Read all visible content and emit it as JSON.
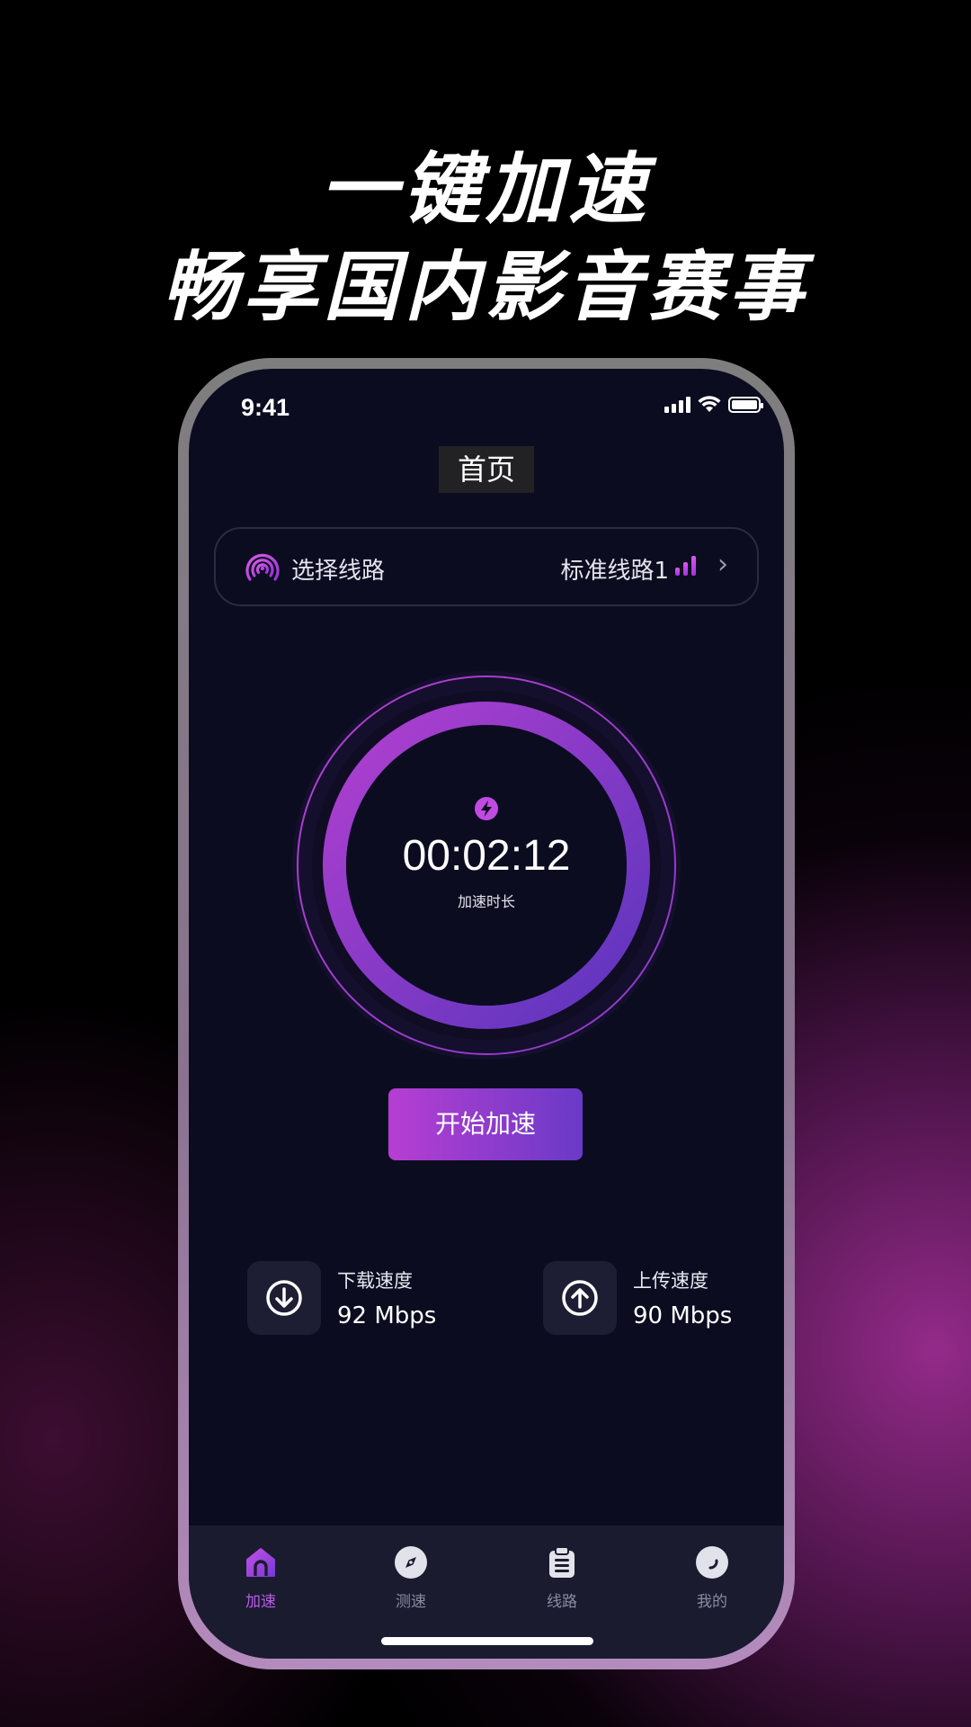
{
  "headline": {
    "line1": "一键加速",
    "line2": "畅享国内影音赛事"
  },
  "status_bar": {
    "time": "9:41"
  },
  "page": {
    "title": "首页"
  },
  "route_selector": {
    "label": "选择线路",
    "value": "标准线路1"
  },
  "timer": {
    "value": "00:02:12",
    "caption": "加速时长"
  },
  "start_button": {
    "label": "开始加速"
  },
  "speeds": {
    "download": {
      "label": "下载速度",
      "value": "92 Mbps"
    },
    "upload": {
      "label": "上传速度",
      "value": "90 Mbps"
    }
  },
  "tabbar": {
    "items": [
      {
        "label": "加速",
        "icon": "home-icon",
        "active": true
      },
      {
        "label": "测速",
        "icon": "compass-icon",
        "active": false
      },
      {
        "label": "线路",
        "icon": "clipboard-icon",
        "active": false
      },
      {
        "label": "我的",
        "icon": "profile-icon",
        "active": false
      }
    ]
  },
  "colors": {
    "accent": "#b85bea",
    "accent_gradient_start": "#b63ed2",
    "accent_gradient_end": "#6a3ac7",
    "screen_bg": "#0c0c20",
    "tabbar_bg": "#1b1b30"
  }
}
